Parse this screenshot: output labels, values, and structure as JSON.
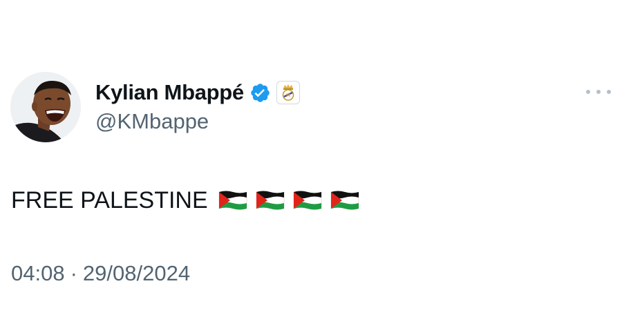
{
  "author": {
    "display_name": "Kylian Mbappé",
    "handle": "@KMbappe",
    "verified_icon": "verified-badge-icon",
    "affiliation_icon": "real-madrid-crest-icon",
    "brand_color": "#1d9bf0"
  },
  "tweet": {
    "text": "FREE PALESTINE",
    "emojis": [
      "palestine-flag",
      "palestine-flag",
      "palestine-flag",
      "palestine-flag"
    ]
  },
  "meta": {
    "time": "04:08",
    "separator": "·",
    "date": "29/08/2024"
  },
  "menu": {
    "icon": "more-options-icon"
  }
}
